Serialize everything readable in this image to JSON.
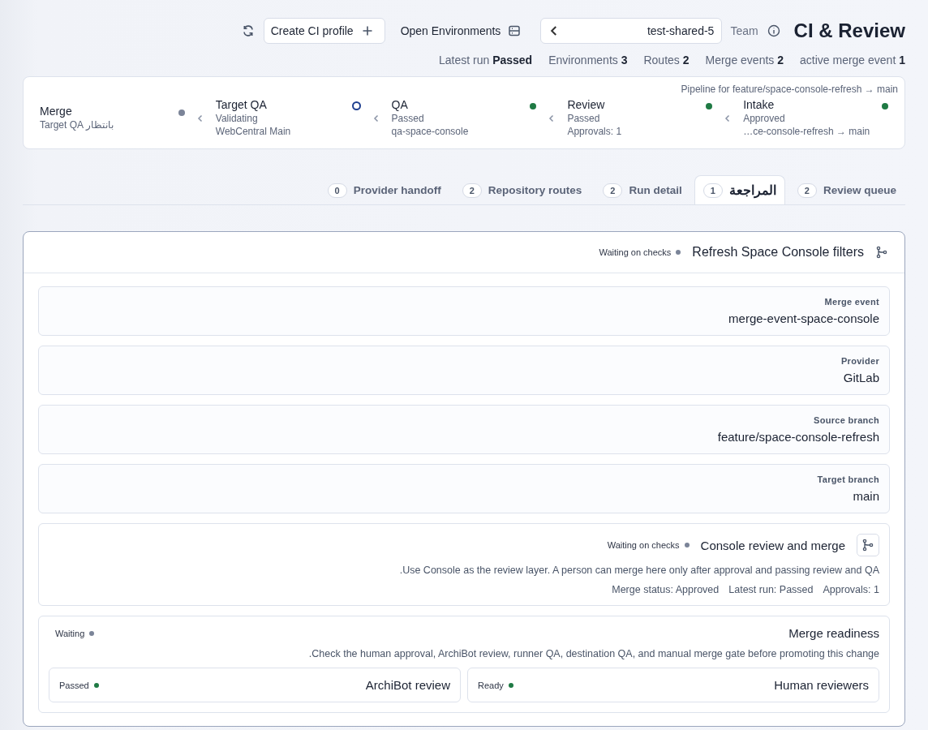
{
  "header": {
    "title": "CI & Review",
    "team_label": "Team",
    "team_field": {
      "value": "test-shared-5"
    },
    "buttons": [
      {
        "label": "Create CI profile",
        "kind": "outlined"
      },
      {
        "label": "Open Environments",
        "kind": "plain"
      }
    ]
  },
  "stats": [
    {
      "label": "Latest run",
      "value": "Passed"
    },
    {
      "label": "Environments",
      "value": "3"
    },
    {
      "label": "Routes",
      "value": "2"
    },
    {
      "label": "Merge events",
      "value": "2"
    },
    {
      "label": "active merge event",
      "value": "1"
    }
  ],
  "pipeline": {
    "caption": "Pipeline for feature/space-console-refresh → main",
    "stages": [
      {
        "name": "Merge",
        "color": "#7b8498",
        "current": false,
        "lines": [
          "بانتظار Target QA"
        ]
      },
      {
        "name": "Target QA",
        "color": "#1f3f8f",
        "current": true,
        "lines": [
          "Validating",
          "WebCentral Main"
        ]
      },
      {
        "name": "QA",
        "color": "#1f7a44",
        "current": false,
        "lines": [
          "Passed",
          "qa-space-console"
        ]
      },
      {
        "name": "Review",
        "color": "#1f7a44",
        "current": false,
        "lines": [
          "Passed",
          "Approvals: 1"
        ]
      },
      {
        "name": "Intake",
        "color": "#1f7a44",
        "current": false,
        "lines": [
          "Approved",
          "…ce-console-refresh → main"
        ]
      }
    ]
  },
  "tabs": [
    {
      "label": "Provider handoff",
      "count": "0",
      "selected": false
    },
    {
      "label": "Repository routes",
      "count": "2",
      "selected": false
    },
    {
      "label": "Run detail",
      "count": "2",
      "selected": false
    },
    {
      "label": "المراجعة",
      "count": "1",
      "selected": true
    },
    {
      "label": "Review queue",
      "count": "2",
      "selected": false
    }
  ],
  "review": {
    "title": "Refresh Space Console filters",
    "status": {
      "label": "Waiting on checks",
      "color": "#7b8498"
    },
    "fields": [
      {
        "label": "Merge event",
        "value": "merge-event-space-console"
      },
      {
        "label": "Provider",
        "value": "GitLab"
      },
      {
        "label": "Source branch",
        "value": "feature/space-console-refresh"
      },
      {
        "label": "Target branch",
        "value": "main"
      }
    ],
    "console": {
      "title": "Console review and merge",
      "status": {
        "label": "Waiting on checks",
        "color": "#7b8498"
      },
      "description": ".Use Console as the review layer. A person can merge here only after approval and passing review and QA",
      "facts": [
        "Merge status: Approved",
        "Latest run: Passed",
        "Approvals: 1"
      ]
    },
    "readiness": {
      "title": "Merge readiness",
      "status": {
        "label": "Waiting",
        "color": "#7b8498"
      },
      "description": ".Check the human approval, ArchiBot review, runner QA, destination QA, and manual merge gate before promoting this change",
      "checks": [
        {
          "title": "ArchiBot review",
          "status": {
            "label": "Passed",
            "color": "#1f7a44"
          }
        },
        {
          "title": "Human reviewers",
          "status": {
            "label": "Ready",
            "color": "#1f7a44"
          }
        }
      ]
    }
  }
}
